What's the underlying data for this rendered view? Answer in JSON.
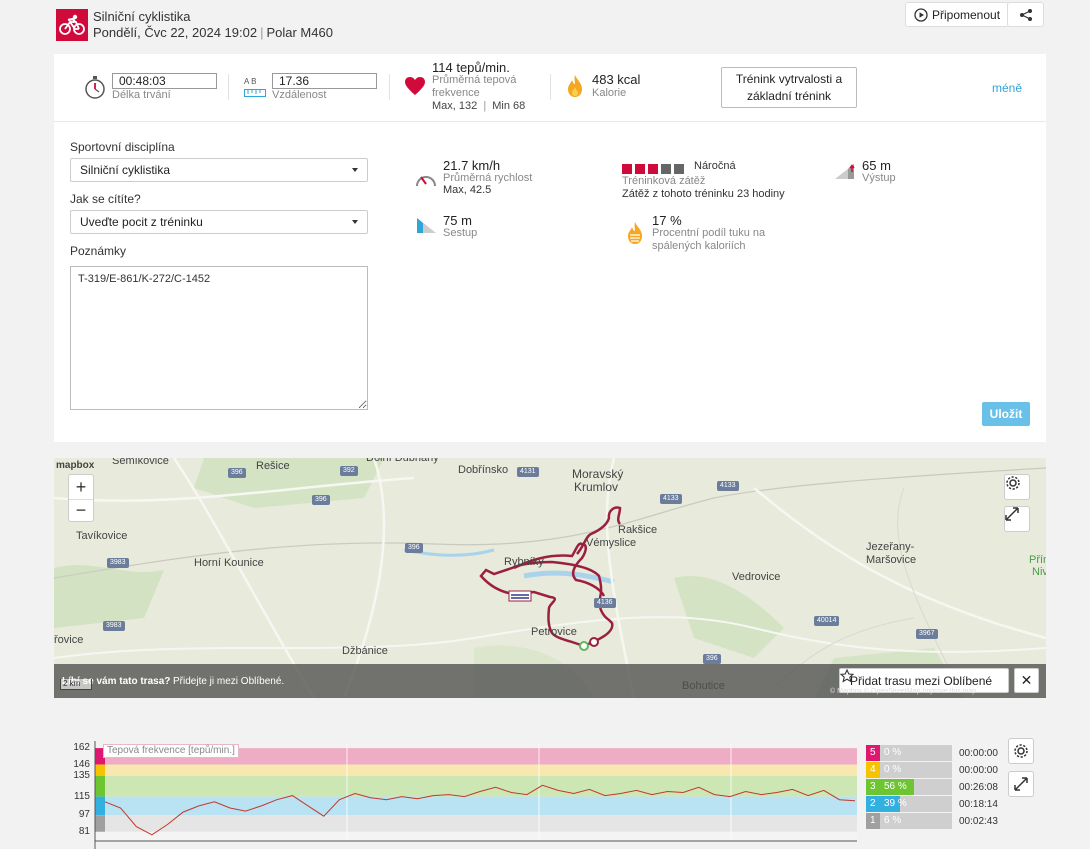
{
  "header": {
    "sport": "Silniční cyklistika",
    "date": "Pondělí, Čvc 22, 2024 19:02",
    "device": "Polar M460",
    "remind_label": "Připomenout"
  },
  "summary": {
    "duration": {
      "value": "00:48:03",
      "label": "Délka trvání"
    },
    "distance": {
      "value": "17.36",
      "label": "Vzdálenost",
      "ab": "A  B"
    },
    "heart_rate": {
      "value": "114 tepů/min.",
      "label": "Průměrná tepová frekvence",
      "max": "Max, 132",
      "min": "Min 68"
    },
    "calories": {
      "value": "483 kcal",
      "label": "Kalorie"
    },
    "training_benefit": "Trénink vytrvalosti a základní trénink",
    "less_link": "méně"
  },
  "form": {
    "sport_label": "Sportovní disciplína",
    "sport_value": "Silniční cyklistika",
    "feeling_label": "Jak se cítíte?",
    "feeling_value": "Uveďte pocit z tréninku",
    "notes_label": "Poznámky",
    "notes_value": "T-319/E-861/K-272/C-1452",
    "save_label": "Uložit"
  },
  "stats": {
    "speed": {
      "value": "21.7 km/h",
      "label": "Průměrná rychlost",
      "max": "Max, 42.5"
    },
    "load": {
      "level": "Náročná",
      "label": "Tréninková zátěž",
      "recovery": "Zátěž z tohoto tréninku 23 hodiny",
      "filled": 3,
      "total": 5
    },
    "ascent": {
      "value": "65 m",
      "label": "Výstup"
    },
    "descent": {
      "value": "75 m",
      "label": "Sestup"
    },
    "fat": {
      "value": "17 %",
      "label": "Procentní podíl tuku na spálených kaloriích"
    }
  },
  "map": {
    "logo": "mapbox",
    "scale": "2 km",
    "places": [
      "Semíkovice",
      "Rešice",
      "Dolní Dubňany",
      "Dobřínsko",
      "Moravský",
      "Krumlov",
      "Rakšice",
      "Tavíkovice",
      "Horní Kounice",
      "Vémyslice",
      "Rybníky",
      "Jezeřany-",
      "Maršovice",
      "Vedrovice",
      "Petrovice",
      "Džbánice",
      "Bohutice",
      "Přím",
      "Niv",
      "řovice"
    ],
    "roads": [
      "396",
      "392",
      "4131",
      "4133",
      "4133",
      "396",
      "396",
      "3983",
      "3983",
      "396",
      "40014",
      "3967",
      "4136"
    ],
    "banner_question": "Líbí se vám tato trasa?",
    "banner_hint": "Přidejte ji mezi Oblíbené.",
    "fav_button": "Přidat trasu mezi Oblíbené",
    "attribution": "© Mapbox © OpenStreetMap Improve this map"
  },
  "hr_chart": {
    "title": "Tepová frekvence [tepů/min.]",
    "y_ticks": [
      "162",
      "146",
      "135",
      "115",
      "97",
      "81"
    ],
    "zones": [
      {
        "zone": "5",
        "percent": "0 %",
        "time": "00:00:00",
        "color": "#e0176e",
        "value": 0
      },
      {
        "zone": "4",
        "percent": "0 %",
        "time": "00:00:00",
        "color": "#f6c300",
        "value": 0
      },
      {
        "zone": "3",
        "percent": "56 %",
        "time": "00:26:08",
        "color": "#6dc531",
        "value": 56
      },
      {
        "zone": "2",
        "percent": "39 %",
        "time": "00:18:14",
        "color": "#32b0e0",
        "value": 39
      },
      {
        "zone": "1",
        "percent": "6 %",
        "time": "00:02:43",
        "color": "#a0a0a0",
        "value": 6
      }
    ]
  },
  "chart_data": {
    "type": "line",
    "title": "Tepová frekvence [tepů/min.]",
    "xlabel": "",
    "ylabel": "Tepová frekvence [tepů/min.]",
    "ylim": [
      72,
      166
    ],
    "y_ticks": [
      162,
      146,
      135,
      115,
      97,
      81
    ],
    "x": [
      0,
      1,
      2,
      3,
      4,
      5,
      6,
      7,
      8,
      9,
      10,
      11,
      12,
      13,
      14,
      15,
      16,
      17,
      18,
      19,
      20,
      21,
      22,
      23,
      24,
      25,
      26,
      27,
      28,
      29,
      30,
      31,
      32,
      33,
      34,
      35,
      36,
      37,
      38,
      39,
      40,
      41,
      42,
      43,
      44,
      45,
      46,
      47,
      48
    ],
    "series": [
      {
        "name": "Tepová frekvence",
        "values": [
          110,
          104,
          86,
          78,
          88,
          100,
          106,
          110,
          104,
          101,
          106,
          112,
          116,
          106,
          96,
          112,
          118,
          114,
          112,
          115,
          113,
          116,
          117,
          115,
          120,
          124,
          119,
          117,
          126,
          121,
          118,
          122,
          116,
          118,
          121,
          117,
          120,
          119,
          124,
          117,
          115,
          120,
          117,
          119,
          122,
          116,
          121,
          112,
          111
        ]
      }
    ]
  }
}
